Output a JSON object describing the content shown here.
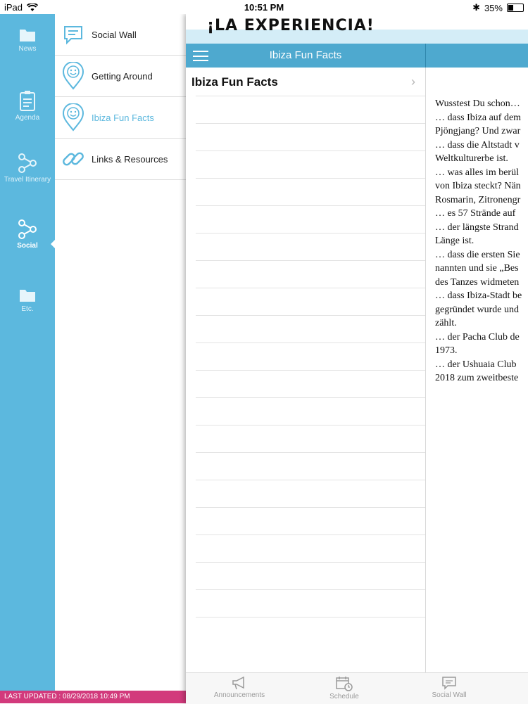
{
  "status_bar": {
    "device": "iPad",
    "time": "10:51 PM",
    "battery": "35%",
    "battery_level": 0.35
  },
  "rail": {
    "items": [
      {
        "label": "News",
        "icon": "folder-icon"
      },
      {
        "label": "Agenda",
        "icon": "clipboard-icon"
      },
      {
        "label": "Travel Itinerary",
        "icon": "share-nodes-icon"
      },
      {
        "label": "Social",
        "icon": "share-nodes-icon",
        "active": true
      },
      {
        "label": "Etc.",
        "icon": "folder-icon"
      }
    ]
  },
  "submenu": {
    "items": [
      {
        "label": "Social Wall",
        "icon": "chat-bubble-icon"
      },
      {
        "label": "Getting Around",
        "icon": "location-pin-smile-icon"
      },
      {
        "label": "Ibiza Fun Facts",
        "icon": "location-pin-smile-icon",
        "active": true
      },
      {
        "label": "Links & Resources",
        "icon": "link-icon"
      }
    ]
  },
  "footer": {
    "last_updated": "LAST UPDATED : 08/29/2018 10:49 PM"
  },
  "header": {
    "logo": "¡LA EXPERIENCIA!",
    "title": "Ibiza Fun Facts"
  },
  "list": {
    "items": [
      {
        "label": "Ibiza Fun Facts"
      }
    ]
  },
  "detail": {
    "lines": [
      "Wusstest Du schon…",
      "… dass Ibiza auf dem",
      "Pjöngjang? Und zwar",
      "… dass die Altstadt v",
      "Weltkulturerbe ist.",
      "… was alles im berül",
      "von Ibiza steckt? Nän",
      "Rosmarin, Zitronengr",
      "… es 57 Strände auf",
      "… der längste Strand",
      "Länge ist.",
      "… dass die ersten Sie",
      "nannten und sie „Bes",
      "des Tanzes widmeten",
      "… dass Ibiza-Stadt be",
      "gegründet wurde und",
      "zählt.",
      "… der Pacha Club de",
      "1973.",
      "… der Ushuaia Club",
      "2018 zum zweitbeste"
    ]
  },
  "tabbar": {
    "tabs": [
      {
        "label": "Announcements",
        "icon": "megaphone-icon"
      },
      {
        "label": "Schedule",
        "icon": "calendar-clock-icon"
      },
      {
        "label": "Social Wall",
        "icon": "chat-bubble-icon"
      }
    ]
  },
  "colors": {
    "rail": "#5cb8de",
    "nav": "#4ea9cf",
    "footer": "#d23a7c",
    "accent": "#5cb8de"
  }
}
